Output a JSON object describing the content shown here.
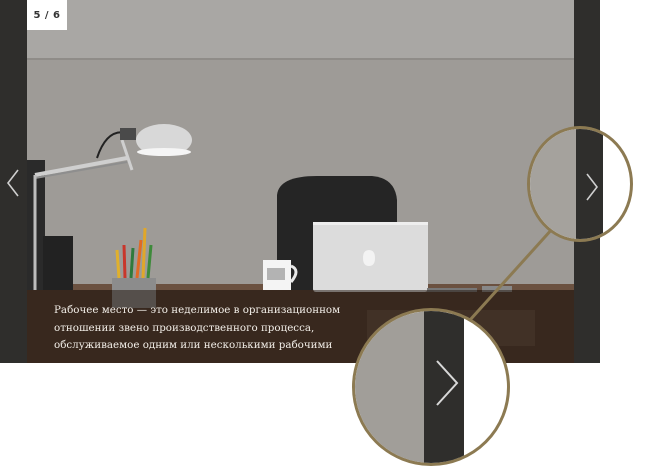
{
  "slider": {
    "counter": "5 / 6",
    "caption": "Рабочее место — это неделимое в организационном отношении звено производственного процесса, обслуживаемое одним или несколькими рабочими",
    "prev_icon": "chevron-left-icon",
    "next_icon": "chevron-right-icon",
    "accent_color": "#8c7a52"
  }
}
